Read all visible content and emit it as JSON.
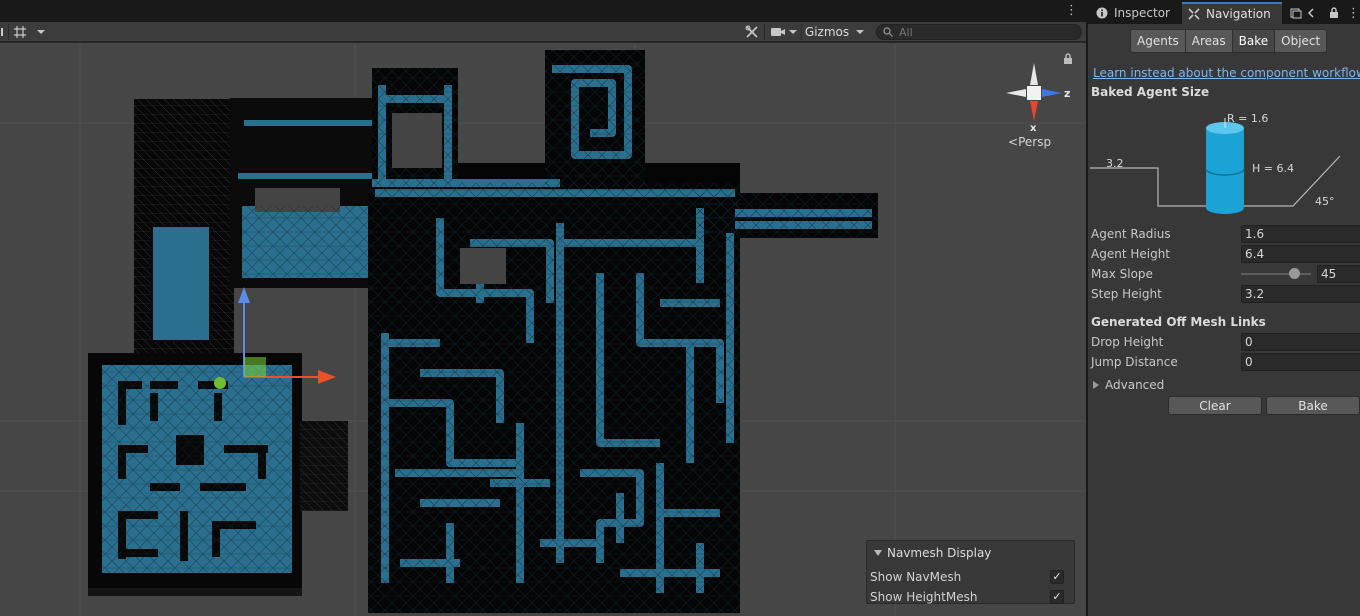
{
  "toolbar": {
    "gizmos_label": "Gizmos",
    "search_placeholder": "All"
  },
  "scene": {
    "persp_label": "Persp",
    "gizmo_axes": {
      "z": "z",
      "x": "x"
    },
    "colors": {
      "background": "#464646",
      "navmesh": "#2a6f8e",
      "walls": "#050505"
    }
  },
  "navmesh_overlay": {
    "title": "Navmesh Display",
    "show_navmesh_label": "Show NavMesh",
    "show_navmesh_checked": true,
    "show_heightmesh_label": "Show HeightMesh",
    "show_heightmesh_checked": true
  },
  "tabs": {
    "inspector": "Inspector",
    "navigation": "Navigation"
  },
  "nav_modes": [
    "Agents",
    "Areas",
    "Bake",
    "Object"
  ],
  "nav_mode_selected": "Bake",
  "workflow_link": "Learn instead about the component workflow.",
  "baked_agent": {
    "title": "Baked Agent Size",
    "radius_label": "R = 1.6",
    "height_label": "H = 6.4",
    "step_label": "3.2",
    "slope_label": "45°"
  },
  "properties": {
    "agent_radius": {
      "label": "Agent Radius",
      "value": "1.6"
    },
    "agent_height": {
      "label": "Agent Height",
      "value": "6.4"
    },
    "max_slope": {
      "label": "Max Slope",
      "value": "45",
      "fraction": 0.75
    },
    "step_height": {
      "label": "Step Height",
      "value": "3.2"
    }
  },
  "off_mesh": {
    "title": "Generated Off Mesh Links",
    "drop_height": {
      "label": "Drop Height",
      "value": "0"
    },
    "jump_distance": {
      "label": "Jump Distance",
      "value": "0"
    }
  },
  "advanced_label": "Advanced",
  "buttons": {
    "clear": "Clear",
    "bake": "Bake"
  },
  "colors": {
    "accent": "#3a79bb",
    "link": "#7eb5f0",
    "agent_cylinder": "#1ba3d6"
  }
}
